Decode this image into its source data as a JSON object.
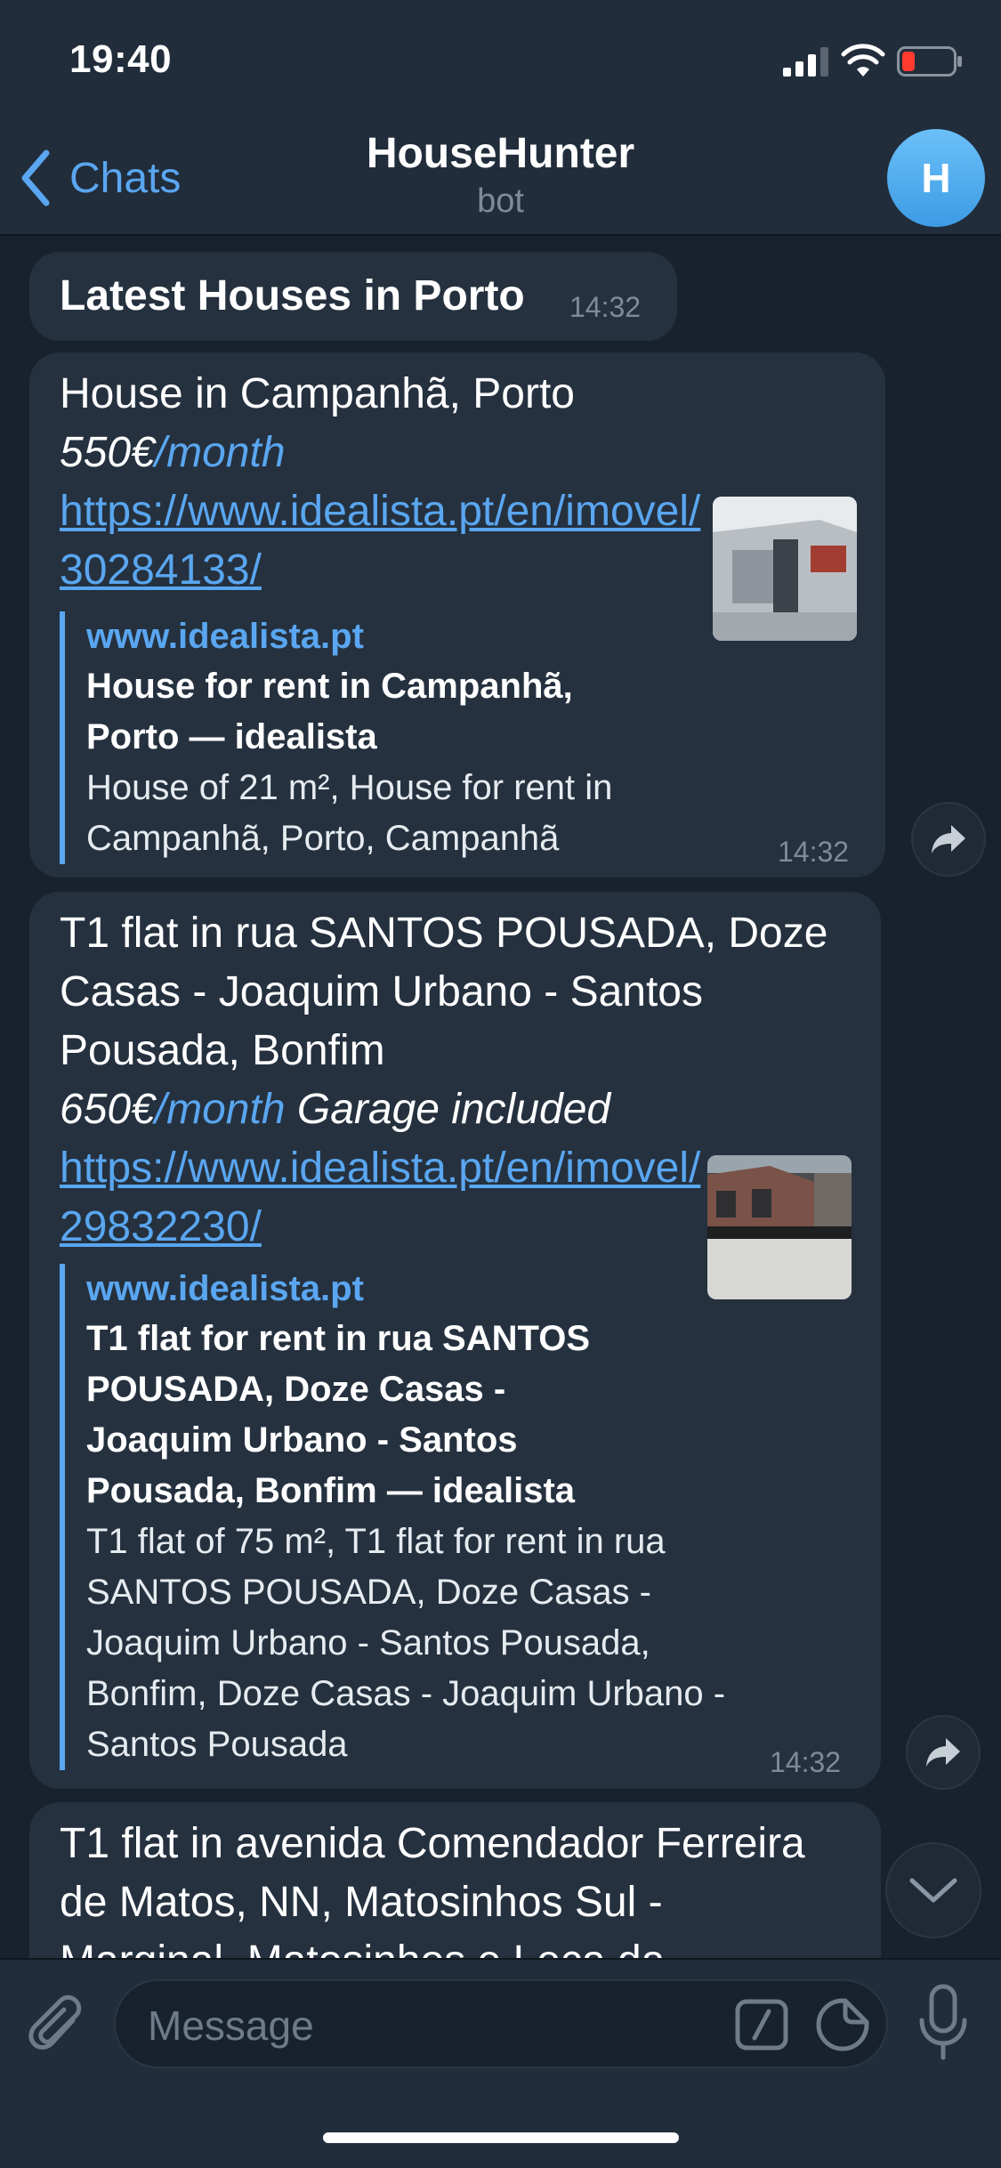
{
  "status_bar": {
    "time": "19:40"
  },
  "nav": {
    "back_label": "Chats",
    "title": "HouseHunter",
    "subtitle": "bot",
    "avatar_letter": "H"
  },
  "messages": [
    {
      "text": "Latest Houses in Porto",
      "time": "14:32"
    },
    {
      "line1": "House in Campanhã, Porto",
      "price": "550€",
      "period": "/month",
      "extra": "",
      "link_line1": "https://www.idealista.pt/en/imovel/",
      "link_line2": "30284133/",
      "preview": {
        "site": "www.idealista.pt",
        "title_lines": [
          "House for rent in Campanhã,",
          "Porto — idealista"
        ],
        "desc_lines": [
          "House of 21 m², House for rent in",
          "Campanhã, Porto, Campanhã"
        ]
      },
      "time": "14:32"
    },
    {
      "line1": "T1 flat in rua SANTOS POUSADA, Doze",
      "line2": "Casas - Joaquim Urbano - Santos",
      "line3": "Pousada, Bonfim",
      "price": "650€",
      "period": "/month",
      "extra": " Garage included",
      "link_line1": "https://www.idealista.pt/en/imovel/",
      "link_line2": "29832230/",
      "preview": {
        "site": "www.idealista.pt",
        "title_lines": [
          "T1 flat for rent in rua SANTOS",
          "POUSADA, Doze Casas -",
          "Joaquim Urbano - Santos",
          "Pousada, Bonfim — idealista"
        ],
        "desc_lines": [
          "T1 flat of 75 m², T1 flat for rent in rua",
          "SANTOS POUSADA, Doze Casas -",
          "Joaquim Urbano - Santos Pousada,",
          "Bonfim, Doze Casas - Joaquim Urbano -",
          "Santos Pousada"
        ]
      },
      "time": "14:32"
    },
    {
      "line1": "T1 flat in avenida Comendador Ferreira",
      "line2": "de Matos, NN, Matosinhos Sul -",
      "line3": "Marginal, Matosinhos e Leça da"
    }
  ],
  "input": {
    "placeholder": "Message"
  },
  "icons": {
    "back": "chevron-left-icon",
    "forward": "share-icon",
    "scroll_down": "chevron-down-icon",
    "attach": "paperclip-icon",
    "commands": "slash-command-icon",
    "sticker": "sticker-icon",
    "mic": "microphone-icon"
  },
  "colors": {
    "accent": "#5aa6f0",
    "bubble": "#25313f",
    "background": "#18222d",
    "bar": "#212d3b"
  }
}
